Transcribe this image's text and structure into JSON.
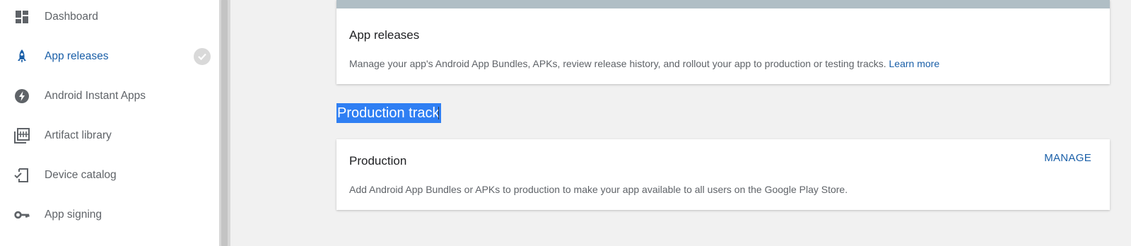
{
  "sidebar": {
    "items": [
      {
        "label": "Dashboard",
        "icon": "dashboard-icon"
      },
      {
        "label": "App releases",
        "icon": "rocket-icon",
        "active": true,
        "status": "completed-check-icon"
      },
      {
        "label": "Android Instant Apps",
        "icon": "instant-apps-bolt-icon"
      },
      {
        "label": "Artifact library",
        "icon": "artifact-library-icon"
      },
      {
        "label": "Device catalog",
        "icon": "device-catalog-icon"
      },
      {
        "label": "App signing",
        "icon": "key-icon"
      }
    ]
  },
  "app_releases_card": {
    "title": "App releases",
    "description": "Manage your app's Android App Bundles, APKs, review release history, and rollout your app to production or testing tracks.",
    "learn_more": "Learn more"
  },
  "production_track": {
    "section_title": "Production track",
    "card": {
      "title": "Production",
      "manage_label": "MANAGE",
      "description": "Add Android App Bundles or APKs to production to make your app available to all users on the Google Play Store."
    }
  },
  "colors": {
    "accent": "#1a5fa8",
    "selection": "#2f7ff3",
    "card_header_bar": "#b0bec5",
    "background": "#f1f1f1"
  }
}
